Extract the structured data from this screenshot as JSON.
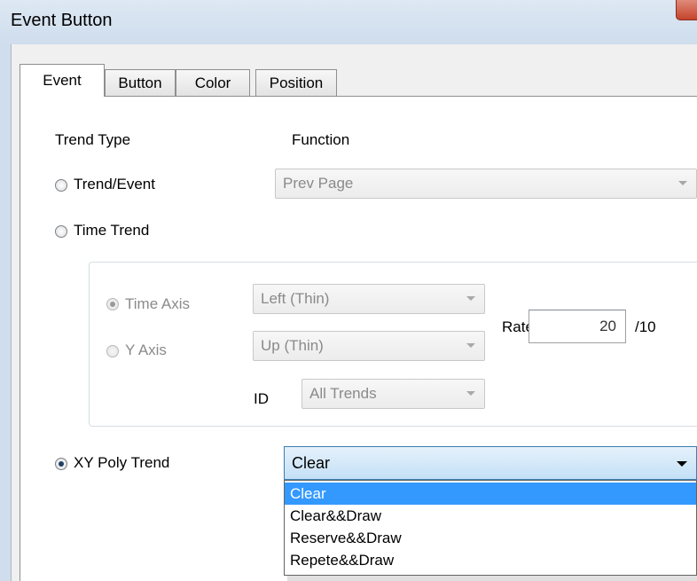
{
  "window": {
    "title": "Event Button"
  },
  "tabs": [
    {
      "label": "Event",
      "active": true
    },
    {
      "label": "Button",
      "active": false
    },
    {
      "label": "Color",
      "active": false
    },
    {
      "label": "Position",
      "active": false
    }
  ],
  "event": {
    "trend_type_label": "Trend Type",
    "function_label": "Function",
    "trend_event": {
      "label": "Trend/Event",
      "selected": false
    },
    "function_value": "Prev Page",
    "time_trend": {
      "label": "Time Trend",
      "selected": false
    },
    "time_axis": {
      "label": "Time Axis",
      "selected": true,
      "value": "Left (Thin)"
    },
    "y_axis": {
      "label": "Y Axis",
      "selected": false,
      "value": "Up (Thin)"
    },
    "id": {
      "label": "ID",
      "value": "All Trends"
    },
    "rate": {
      "label": "Rate",
      "value": "20",
      "unit": "/10"
    },
    "xy_poly_trend": {
      "label": "XY Poly Trend",
      "selected": true
    },
    "xy_combo": {
      "value": "Clear",
      "options": [
        "Clear",
        "Clear&&Draw",
        "Reserve&&Draw",
        "Repete&&Draw"
      ],
      "highlighted_index": 0
    }
  },
  "colors": {
    "highlight": "#3399ff",
    "disabled_text": "#8a8a8a",
    "titlebar": "#dde8f3"
  }
}
